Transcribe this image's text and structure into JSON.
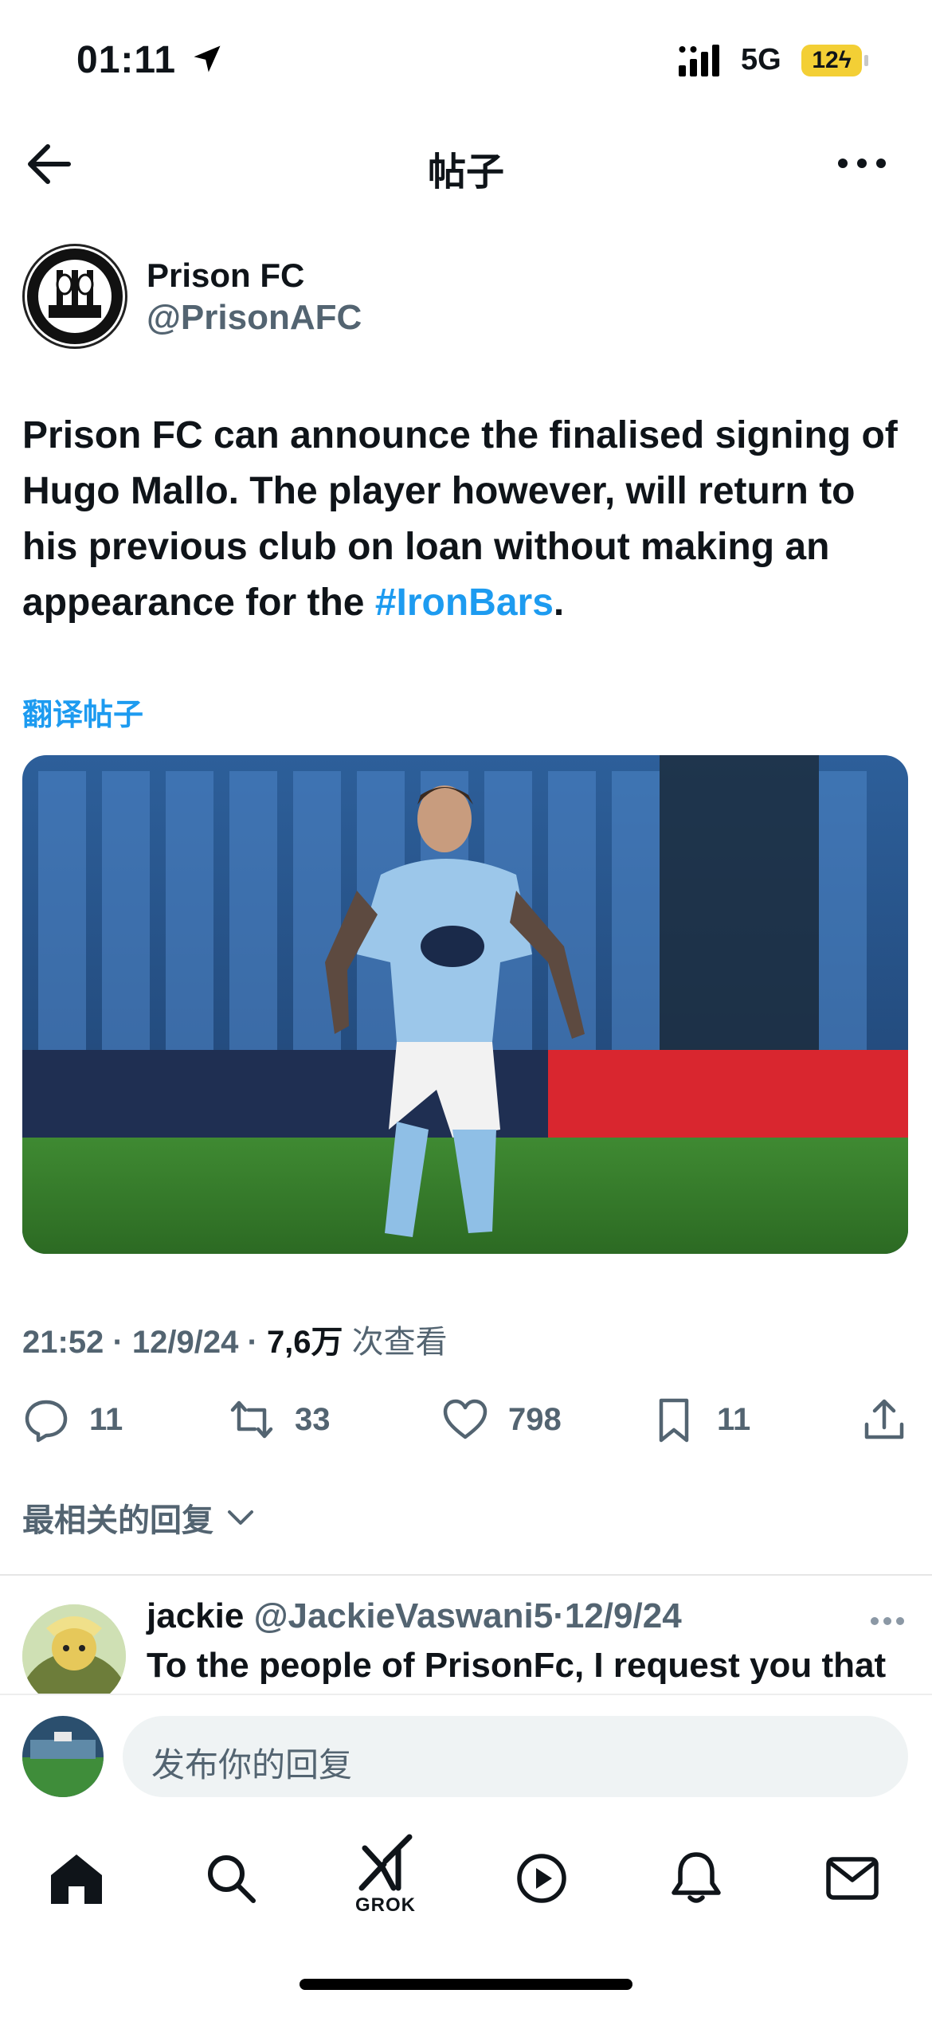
{
  "status_bar": {
    "time": "01:11",
    "network": "5G",
    "battery": "12"
  },
  "header": {
    "title": "帖子",
    "icons": [
      "back-arrow-icon",
      "more-icon"
    ]
  },
  "tweet": {
    "author_name": "Prison FC",
    "author_handle": "@PrisonAFC",
    "text_before": "Prison FC can announce the finalised signing of Hugo Mallo. The player however, will return to his previous club on loan without making an appearance for the ",
    "hashtag": "#IronBars",
    "text_after": ".",
    "translate_label": "翻译帖子",
    "time": "21:52",
    "date": "12/9/24",
    "views_count": "7,6万",
    "views_label": "次查看",
    "sep": "·"
  },
  "actions": {
    "replies": "11",
    "retweets": "33",
    "likes": "798",
    "bookmarks": "11"
  },
  "sort_label": "最相关的回复",
  "reply": {
    "name": "jackie",
    "handle": "@JackieVaswani5",
    "sep": "·",
    "date": "12/9/24",
    "text": "To the people of PrisonFc, I request you that"
  },
  "composer": {
    "placeholder": "发布你的回复"
  },
  "tabbar": {
    "grok_label": "GROK",
    "tabs": [
      "home-icon",
      "search-icon",
      "grok-icon",
      "video-icon",
      "notifications-icon",
      "messages-icon"
    ]
  },
  "colors": {
    "accent": "#1d9bf0",
    "secondary_text": "#536471",
    "battery": "#f3cf35"
  }
}
